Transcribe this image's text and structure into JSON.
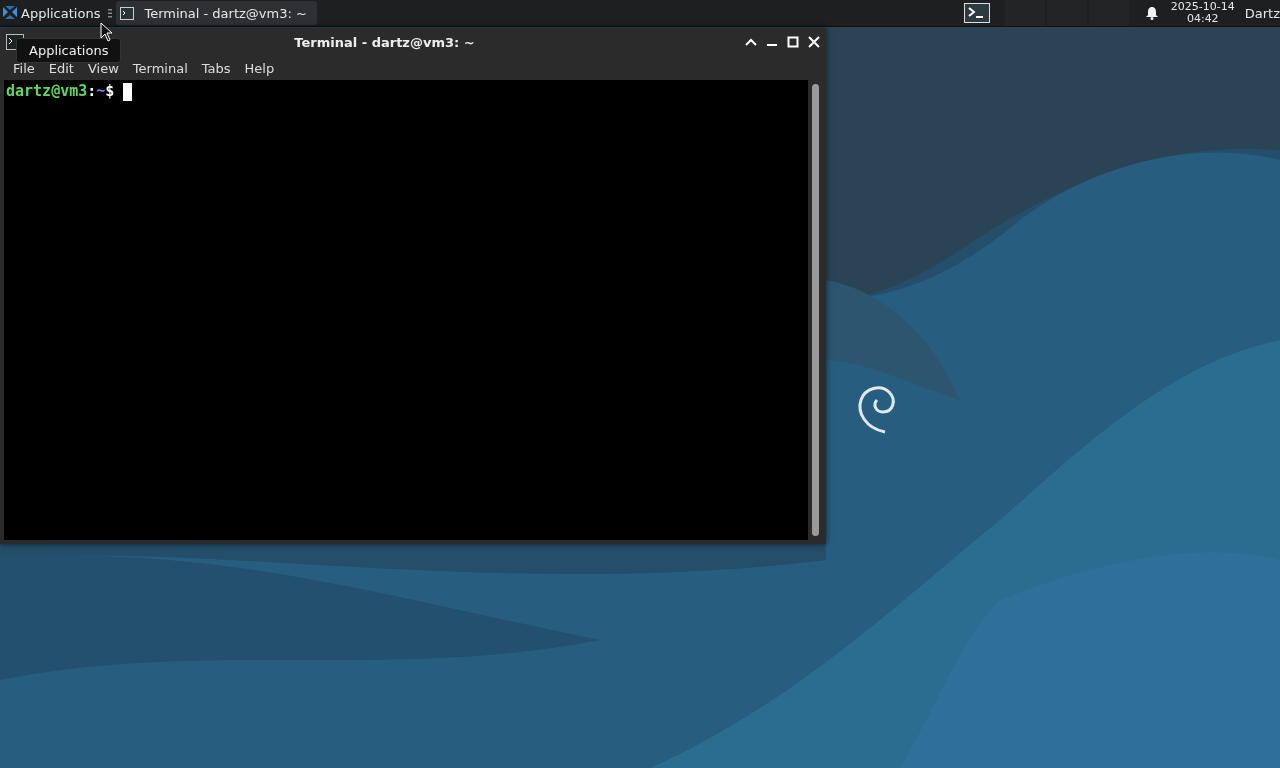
{
  "panel": {
    "menu_label": "Applications",
    "tasks": [
      {
        "title": "Terminal - dartz@vm3: ~",
        "selected": true
      }
    ],
    "workspaces": [
      {
        "selected": false
      },
      {
        "selected": false
      },
      {
        "selected": false
      }
    ],
    "clock": {
      "date": "2025-10-14",
      "time": "04:42"
    },
    "user": "Dartz"
  },
  "tooltip": {
    "text": "Applications"
  },
  "window": {
    "title": "Terminal - dartz@vm3: ~",
    "menu": [
      "File",
      "Edit",
      "View",
      "Terminal",
      "Tabs",
      "Help"
    ],
    "prompt": {
      "user_host": "dartz@vm3",
      "separator": ":",
      "path": "~",
      "symbol": "$"
    }
  }
}
